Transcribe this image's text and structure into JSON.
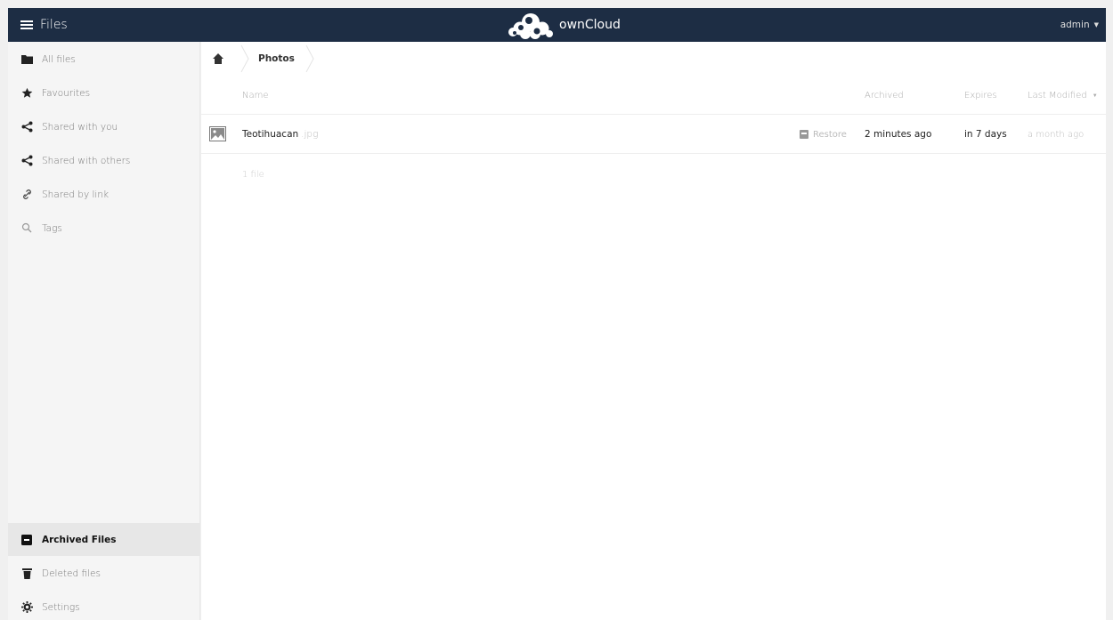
{
  "header": {
    "app_title": "Files",
    "brand": "ownCloud",
    "user": "admin"
  },
  "sidebar": {
    "items": [
      {
        "label": "All files",
        "icon": "folder-icon"
      },
      {
        "label": "Favourites",
        "icon": "star-icon"
      },
      {
        "label": "Shared with you",
        "icon": "share-icon"
      },
      {
        "label": "Shared with others",
        "icon": "share-icon"
      },
      {
        "label": "Shared by link",
        "icon": "link-icon"
      },
      {
        "label": "Tags",
        "icon": "tag-search-icon"
      }
    ],
    "bottom_items": [
      {
        "label": "Archived Files",
        "icon": "archive-icon",
        "active": true
      },
      {
        "label": "Deleted files",
        "icon": "trash-icon"
      },
      {
        "label": "Settings",
        "icon": "gear-icon"
      }
    ]
  },
  "breadcrumb": {
    "current": "Photos"
  },
  "table": {
    "columns": {
      "name": "Name",
      "archived": "Archived",
      "expires": "Expires",
      "modified": "Last Modified"
    },
    "rows": [
      {
        "name": "Teotihuacan",
        "ext": ".jpg",
        "action": "Restore",
        "archived": "2 minutes ago",
        "expires": "in 7 days",
        "modified": "a month ago"
      }
    ],
    "summary": "1 file"
  },
  "colors": {
    "header_bg": "#1d2d44",
    "active_nav_bg": "#e7e7e7"
  }
}
